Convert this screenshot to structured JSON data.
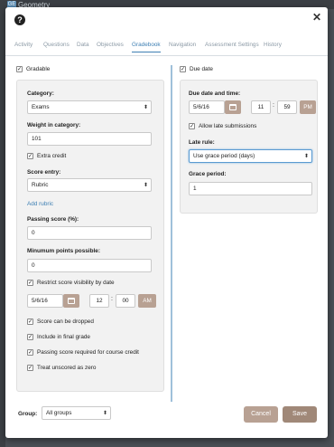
{
  "background": {
    "app_tab": "Geometry",
    "badge": "GE"
  },
  "tabs": [
    {
      "label": "Activity"
    },
    {
      "label": "Questions"
    },
    {
      "label": "Data"
    },
    {
      "label": "Objectives"
    },
    {
      "label": "Gradebook",
      "active": true
    },
    {
      "label": "Navigation"
    },
    {
      "label": "Assessment Settings"
    },
    {
      "label": "History"
    }
  ],
  "gradable": {
    "label": "Gradable",
    "checked": true
  },
  "left": {
    "category_label": "Category:",
    "category_value": "Exams",
    "weight_label": "Weight in category:",
    "weight_value": "101",
    "extra_credit": {
      "label": "Extra credit",
      "checked": true
    },
    "score_entry_label": "Score entry:",
    "score_entry_value": "Rubric",
    "add_rubric": "Add rubric",
    "passing_label": "Passing score (%):",
    "passing_value": "0",
    "minimum_label": "Minumum points possible:",
    "minimum_value": "0",
    "restrict": {
      "label": "Restrict score visibility by date",
      "checked": true
    },
    "restrict_date": "5/6/16",
    "restrict_hour": "12",
    "restrict_min": "00",
    "restrict_ampm": "AM",
    "checks": [
      {
        "label": "Score can be dropped",
        "checked": true
      },
      {
        "label": "Include in final grade",
        "checked": true
      },
      {
        "label": "Passing score required for course credit",
        "checked": true
      },
      {
        "label": "Treat unscored as zero",
        "checked": true
      }
    ]
  },
  "right": {
    "due_date": {
      "label": "Due date",
      "checked": true
    },
    "due_label": "Due date and time:",
    "due_date_value": "5/6/16",
    "due_hour": "11",
    "due_min": "59",
    "due_ampm": "PM",
    "allow_late": {
      "label": "Allow late submissions",
      "checked": true
    },
    "late_rule_label": "Late rule:",
    "late_rule_value": "Use grace period (days)",
    "grace_label": "Grace period:",
    "grace_value": "1"
  },
  "footer": {
    "group_label": "Group:",
    "group_value": "All groups",
    "cancel": "Cancel",
    "save": "Save"
  },
  "colors": {
    "accent": "#3e7fb3",
    "button": "#b8a193",
    "save": "#a08878"
  },
  "icons": {
    "help": "help-circle-icon",
    "close": "close-icon",
    "calendar": "calendar-icon",
    "checkbox": "check-icon"
  }
}
